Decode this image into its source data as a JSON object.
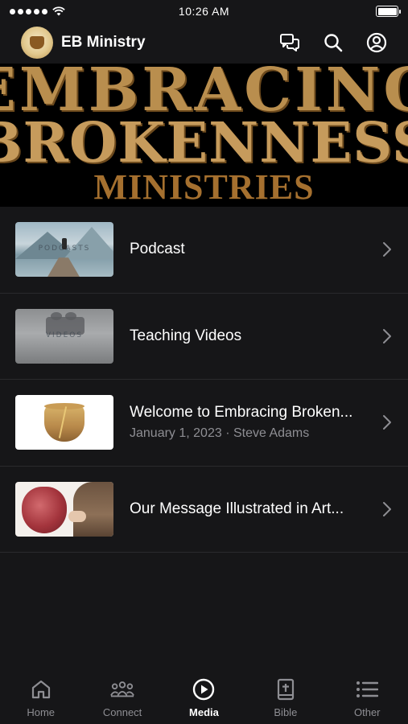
{
  "status_bar": {
    "time": "10:26 AM"
  },
  "header": {
    "app_title": "EB Ministry",
    "icons": [
      "chat-icon",
      "search-icon",
      "account-icon"
    ]
  },
  "banner": {
    "line1": "EMBRACING",
    "line2": "BROKENNESS",
    "line3": "MINISTRIES"
  },
  "media_items": [
    {
      "title": "Podcast",
      "subtitle": "",
      "thumb_label": "PODCASTS"
    },
    {
      "title": "Teaching Videos",
      "subtitle": "",
      "thumb_label": "VIDEOS"
    },
    {
      "title": "Welcome to Embracing Broken...",
      "subtitle": "January 1, 2023 · Steve Adams"
    },
    {
      "title": "Our Message Illustrated in Art...",
      "subtitle": ""
    }
  ],
  "tabs": [
    {
      "label": "Home",
      "icon": "home-icon",
      "active": false
    },
    {
      "label": "Connect",
      "icon": "group-icon",
      "active": false
    },
    {
      "label": "Media",
      "icon": "play-circle-icon",
      "active": true
    },
    {
      "label": "Bible",
      "icon": "bible-icon",
      "active": false
    },
    {
      "label": "Other",
      "icon": "list-icon",
      "active": false
    }
  ],
  "colors": {
    "background": "#161618",
    "banner_gold": "#b98e4e",
    "inactive_tab": "#8e8e93",
    "active_tab": "#ffffff"
  }
}
